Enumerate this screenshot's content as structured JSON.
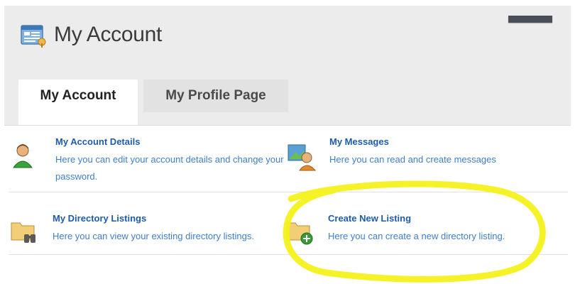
{
  "header": {
    "title": "My Account",
    "title_icon": "account-panel-icon"
  },
  "tabs": [
    {
      "label": "My Account",
      "active": true
    },
    {
      "label": "My Profile Page",
      "active": false
    }
  ],
  "items": [
    {
      "title": "My Account Details",
      "description": "Here you can edit your account details and change your password.",
      "icon": "user-icon"
    },
    {
      "title": "My Messages",
      "description": "Here you can read and create messages",
      "icon": "messages-icon"
    },
    {
      "title": "My Directory Listings",
      "description": "Here you can view your existing directory listings.",
      "icon": "folder-binoculars-icon"
    },
    {
      "title": "Create New Listing",
      "description": "Here you can create a new directory listing.",
      "icon": "folder-add-icon"
    }
  ],
  "colors": {
    "header_bg": "#ececec",
    "link_title": "#1d5ca7",
    "link_desc": "#3f7fc7",
    "highlight": "#f4f21c"
  }
}
